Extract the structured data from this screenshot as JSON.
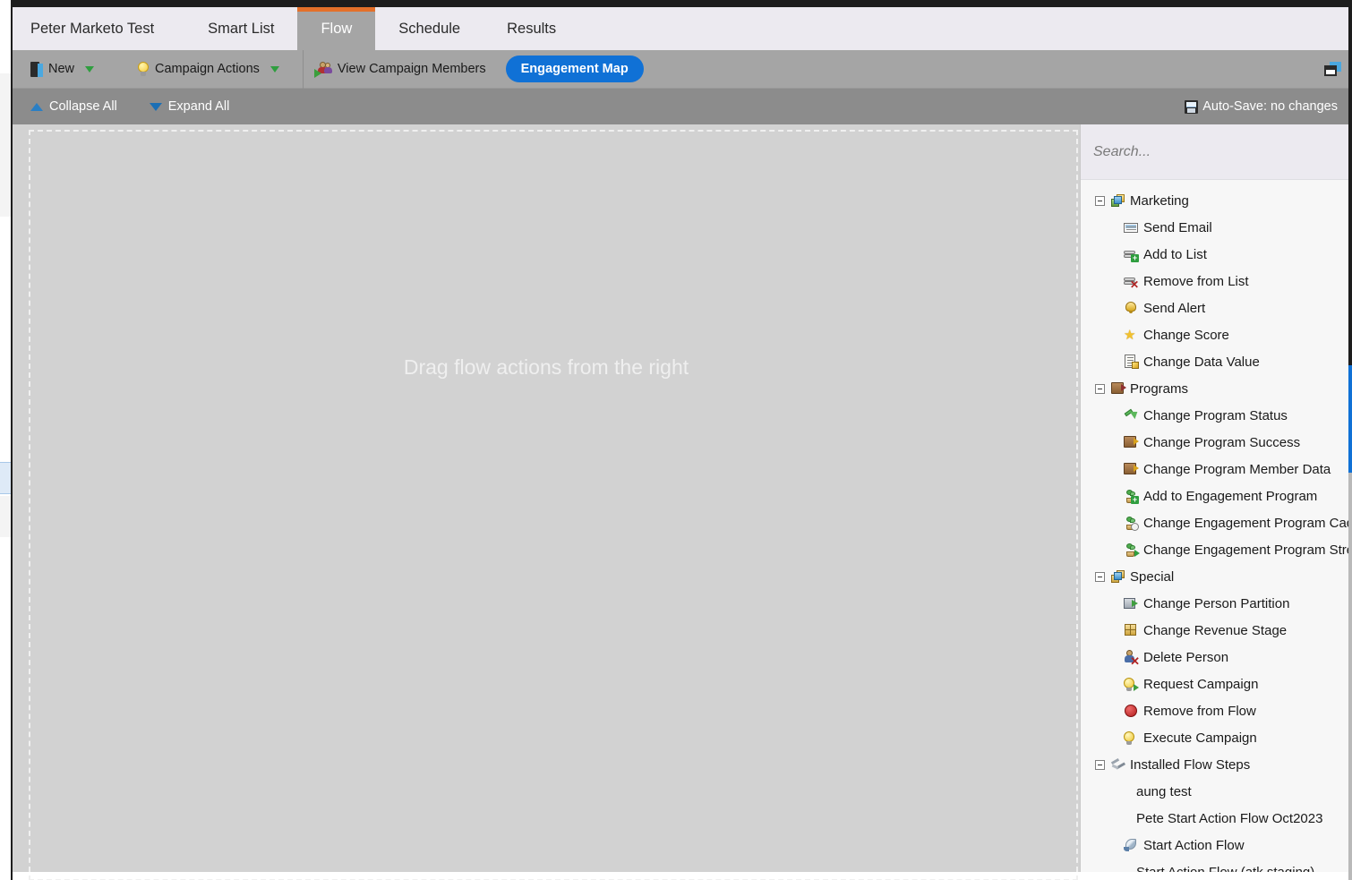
{
  "tabs": [
    {
      "label": "Peter Marketo Test",
      "active": false
    },
    {
      "label": "Smart List",
      "active": false
    },
    {
      "label": "Flow",
      "active": true
    },
    {
      "label": "Schedule",
      "active": false
    },
    {
      "label": "Results",
      "active": false
    }
  ],
  "toolbar": {
    "new_label": "New",
    "campaign_actions_label": "Campaign Actions",
    "view_members_label": "View Campaign Members",
    "engagement_map_label": "Engagement Map",
    "accent_blue": "#1071d6",
    "active_tab_orange": "#e4702a",
    "bar_grey": "#a5a5a5"
  },
  "subbar": {
    "collapse_all_label": "Collapse All",
    "expand_all_label": "Expand All",
    "autosave_label": "Auto-Save: no changes",
    "bar_grey": "#8c8c8c"
  },
  "canvas": {
    "drop_hint": "Drag flow actions from the right",
    "background": "#d2d2d2",
    "dash_color": "#f0f0f0"
  },
  "palette": {
    "search_placeholder": "Search...",
    "search_value": "",
    "groups": [
      {
        "label": "Marketing",
        "icon": "marketing-folder-icon",
        "expanded": true,
        "items": [
          {
            "label": "Send Email",
            "icon": "envelope-icon"
          },
          {
            "label": "Add to List",
            "icon": "list-add-icon"
          },
          {
            "label": "Remove from List",
            "icon": "list-remove-icon"
          },
          {
            "label": "Send Alert",
            "icon": "bell-icon"
          },
          {
            "label": "Change Score",
            "icon": "star-icon"
          },
          {
            "label": "Change Data Value",
            "icon": "document-edit-icon"
          }
        ]
      },
      {
        "label": "Programs",
        "icon": "program-book-icon",
        "expanded": true,
        "items": [
          {
            "label": "Change Program Status",
            "icon": "green-arrow-icon"
          },
          {
            "label": "Change Program Success",
            "icon": "program-edit-icon"
          },
          {
            "label": "Change Program Member Data",
            "icon": "program-edit-icon"
          },
          {
            "label": "Add to Engagement Program",
            "icon": "plant-add-icon"
          },
          {
            "label": "Change Engagement Program Cadence",
            "icon": "plant-clock-icon"
          },
          {
            "label": "Change Engagement Program Stream",
            "icon": "plant-arrow-icon"
          }
        ]
      },
      {
        "label": "Special",
        "icon": "special-folder-icon",
        "expanded": true,
        "items": [
          {
            "label": "Change Person Partition",
            "icon": "partition-icon"
          },
          {
            "label": "Change Revenue Stage",
            "icon": "revenue-cube-icon"
          },
          {
            "label": "Delete Person",
            "icon": "delete-person-icon"
          },
          {
            "label": "Request Campaign",
            "icon": "campaign-bulb-icon"
          },
          {
            "label": "Remove from Flow",
            "icon": "stop-sign-icon"
          },
          {
            "label": "Execute Campaign",
            "icon": "campaign-bulb-icon"
          }
        ]
      },
      {
        "label": "Installed Flow Steps",
        "icon": "installed-steps-icon",
        "expanded": true,
        "items": [
          {
            "label": "aung test",
            "icon": "none"
          },
          {
            "label": "Pete Start Action Flow Oct2023",
            "icon": "none"
          },
          {
            "label": "Start Action Flow",
            "icon": "rocket-icon"
          },
          {
            "label": "Start Action Flow (atk staging)",
            "icon": "none"
          }
        ]
      }
    ]
  }
}
